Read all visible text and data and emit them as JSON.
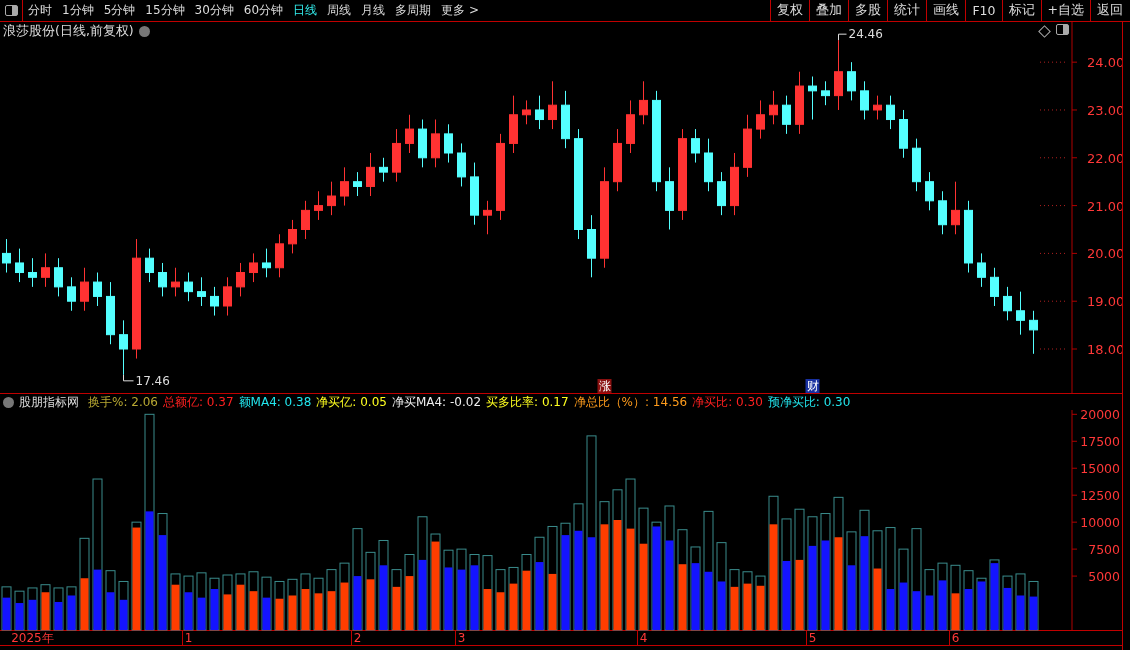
{
  "toolbar": {
    "periods": [
      {
        "label": "分时",
        "selected": false
      },
      {
        "label": "1分钟",
        "selected": false
      },
      {
        "label": "5分钟",
        "selected": false
      },
      {
        "label": "15分钟",
        "selected": false
      },
      {
        "label": "30分钟",
        "selected": false
      },
      {
        "label": "60分钟",
        "selected": false
      },
      {
        "label": "日线",
        "selected": true
      },
      {
        "label": "周线",
        "selected": false
      },
      {
        "label": "月线",
        "selected": false
      },
      {
        "label": "多周期",
        "selected": false
      },
      {
        "label": "更多 >",
        "selected": false
      }
    ],
    "actions": [
      "复权",
      "叠加",
      "多股",
      "统计",
      "画线",
      "F10",
      "标记",
      "+自选",
      "返回"
    ]
  },
  "price_panel": {
    "title": "浪莎股份(日线,前复权)",
    "chart_data": {
      "type": "candlestick",
      "ylim": [
        17.08,
        24.84
      ],
      "yticks": [
        {
          "value": 18,
          "label": "18.00"
        },
        {
          "value": 19,
          "label": "19.00"
        },
        {
          "value": 20,
          "label": "20.00"
        },
        {
          "value": 21,
          "label": "21.00"
        },
        {
          "value": 22,
          "label": "22.00"
        },
        {
          "value": 23,
          "label": "23.00"
        },
        {
          "value": 24,
          "label": "24.00"
        }
      ],
      "categories": [
        null,
        null,
        null,
        null,
        null,
        null,
        null,
        null,
        null,
        null,
        null,
        null,
        null,
        null,
        null,
        null,
        null,
        null,
        null,
        null,
        null,
        null,
        null,
        null,
        null,
        null,
        null,
        null,
        null,
        null,
        null,
        null,
        null,
        null,
        null,
        null,
        null,
        null,
        null,
        null,
        null,
        null,
        null,
        null,
        null,
        null,
        "涨",
        null,
        null,
        null,
        null,
        null,
        null,
        null,
        null,
        null,
        null,
        null,
        null,
        null,
        null,
        null,
        "财",
        null,
        null,
        null,
        null,
        null,
        null,
        null,
        null,
        null,
        null,
        null,
        null,
        null,
        null,
        null,
        null,
        null
      ],
      "ohlc": [
        [
          20.0,
          20.3,
          19.6,
          19.8
        ],
        [
          19.8,
          20.1,
          19.4,
          19.6
        ],
        [
          19.6,
          19.9,
          19.3,
          19.5
        ],
        [
          19.5,
          20.0,
          19.3,
          19.7
        ],
        [
          19.7,
          19.9,
          19.1,
          19.3
        ],
        [
          19.3,
          19.5,
          18.8,
          19.0
        ],
        [
          19.0,
          19.7,
          18.8,
          19.4
        ],
        [
          19.4,
          19.6,
          18.9,
          19.1
        ],
        [
          19.1,
          19.4,
          18.1,
          18.3
        ],
        [
          18.3,
          18.6,
          17.46,
          18.0
        ],
        [
          18.0,
          20.3,
          17.8,
          19.9
        ],
        [
          19.9,
          20.1,
          19.4,
          19.6
        ],
        [
          19.6,
          19.8,
          19.1,
          19.3
        ],
        [
          19.3,
          19.7,
          19.1,
          19.4
        ],
        [
          19.4,
          19.6,
          19.0,
          19.2
        ],
        [
          19.2,
          19.5,
          18.9,
          19.1
        ],
        [
          19.1,
          19.3,
          18.7,
          18.9
        ],
        [
          18.9,
          19.5,
          18.7,
          19.3
        ],
        [
          19.3,
          19.8,
          19.1,
          19.6
        ],
        [
          19.6,
          20.0,
          19.4,
          19.8
        ],
        [
          19.8,
          20.1,
          19.5,
          19.7
        ],
        [
          19.7,
          20.4,
          19.5,
          20.2
        ],
        [
          20.2,
          20.7,
          20.0,
          20.5
        ],
        [
          20.5,
          21.1,
          20.3,
          20.9
        ],
        [
          20.9,
          21.3,
          20.7,
          21.0
        ],
        [
          21.0,
          21.5,
          20.8,
          21.2
        ],
        [
          21.2,
          21.8,
          21.0,
          21.5
        ],
        [
          21.5,
          21.7,
          21.2,
          21.4
        ],
        [
          21.4,
          22.1,
          21.2,
          21.8
        ],
        [
          21.8,
          22.0,
          21.5,
          21.7
        ],
        [
          21.7,
          22.6,
          21.5,
          22.3
        ],
        [
          22.3,
          22.9,
          22.1,
          22.6
        ],
        [
          22.6,
          22.8,
          21.8,
          22.0
        ],
        [
          22.0,
          22.8,
          21.8,
          22.5
        ],
        [
          22.5,
          22.7,
          21.9,
          22.1
        ],
        [
          22.1,
          22.3,
          21.4,
          21.6
        ],
        [
          21.6,
          21.9,
          20.6,
          20.8
        ],
        [
          20.8,
          21.1,
          20.4,
          20.9
        ],
        [
          20.9,
          22.5,
          20.7,
          22.3
        ],
        [
          22.3,
          23.3,
          22.1,
          22.9
        ],
        [
          22.9,
          23.2,
          22.7,
          23.0
        ],
        [
          23.0,
          23.3,
          22.6,
          22.8
        ],
        [
          22.8,
          23.6,
          22.6,
          23.1
        ],
        [
          23.1,
          23.4,
          22.2,
          22.4
        ],
        [
          22.4,
          22.6,
          20.3,
          20.5
        ],
        [
          20.5,
          20.8,
          19.5,
          19.9
        ],
        [
          19.9,
          21.8,
          19.7,
          21.5
        ],
        [
          21.5,
          22.6,
          21.3,
          22.3
        ],
        [
          22.3,
          23.2,
          22.1,
          22.9
        ],
        [
          22.9,
          23.6,
          22.7,
          23.2
        ],
        [
          23.2,
          23.4,
          21.3,
          21.5
        ],
        [
          21.5,
          21.8,
          20.5,
          20.9
        ],
        [
          20.9,
          22.6,
          20.7,
          22.4
        ],
        [
          22.4,
          22.6,
          21.9,
          22.1
        ],
        [
          22.1,
          22.4,
          21.3,
          21.5
        ],
        [
          21.5,
          21.7,
          20.8,
          21.0
        ],
        [
          21.0,
          22.1,
          20.8,
          21.8
        ],
        [
          21.8,
          22.9,
          21.6,
          22.6
        ],
        [
          22.6,
          23.2,
          22.4,
          22.9
        ],
        [
          22.9,
          23.4,
          22.7,
          23.1
        ],
        [
          23.1,
          23.3,
          22.5,
          22.7
        ],
        [
          22.7,
          23.8,
          22.5,
          23.5
        ],
        [
          23.5,
          23.7,
          22.8,
          23.4
        ],
        [
          23.4,
          23.6,
          23.1,
          23.3
        ],
        [
          23.3,
          24.46,
          23.0,
          23.8
        ],
        [
          23.8,
          24.0,
          23.2,
          23.4
        ],
        [
          23.4,
          23.6,
          22.8,
          23.0
        ],
        [
          23.0,
          23.3,
          22.8,
          23.1
        ],
        [
          23.1,
          23.3,
          22.6,
          22.8
        ],
        [
          22.8,
          23.0,
          22.0,
          22.2
        ],
        [
          22.2,
          22.4,
          21.3,
          21.5
        ],
        [
          21.5,
          21.7,
          20.9,
          21.1
        ],
        [
          21.1,
          21.3,
          20.4,
          20.6
        ],
        [
          20.6,
          21.5,
          20.4,
          20.9
        ],
        [
          20.9,
          21.1,
          19.6,
          19.8
        ],
        [
          19.8,
          20.0,
          19.3,
          19.5
        ],
        [
          19.5,
          19.7,
          18.9,
          19.1
        ],
        [
          19.1,
          19.3,
          18.6,
          18.8
        ],
        [
          18.8,
          19.2,
          18.3,
          18.6
        ],
        [
          18.6,
          18.8,
          17.9,
          18.4
        ]
      ],
      "annotations": [
        "17.46",
        "24.46"
      ]
    }
  },
  "indicator_panel": {
    "title": "股朋指标网",
    "readouts": [
      {
        "label": "换手%:",
        "value": "2.06",
        "color": "#b8a832"
      },
      {
        "label": "总额亿:",
        "value": "0.37",
        "color": "#ff2020"
      },
      {
        "label": "额MA4:",
        "value": "0.38",
        "color": "#22e6ee"
      },
      {
        "label": "净买亿:",
        "value": "0.05",
        "color": "#ffff20"
      },
      {
        "label": "净买MA4:",
        "value": "-0.02",
        "color": "#eeeeee"
      },
      {
        "label": "买多比率:",
        "value": "0.17",
        "color": "#ffff20"
      },
      {
        "label": "净总比（%）:",
        "value": "14.56",
        "color": "#ff9c1c"
      },
      {
        "label": "净买比:",
        "value": "0.30",
        "color": "#ff2020"
      },
      {
        "label": "预净买比:",
        "value": "0.30",
        "color": "#22e6ee"
      }
    ],
    "chart_data": {
      "type": "bar",
      "ylim": [
        0,
        20400
      ],
      "yticks": [
        {
          "value": 5000,
          "label": "5000"
        },
        {
          "value": 7500,
          "label": "7500"
        },
        {
          "value": 10000,
          "label": "10000"
        },
        {
          "value": 12500,
          "label": "12500"
        },
        {
          "value": 15000,
          "label": "15000"
        },
        {
          "value": 17500,
          "label": "17500"
        },
        {
          "value": 20000,
          "label": "20000"
        }
      ],
      "categories": [
        null,
        null,
        "2025年",
        null,
        null,
        null,
        null,
        null,
        null,
        null,
        null,
        null,
        null,
        null,
        "1",
        null,
        null,
        null,
        null,
        null,
        null,
        null,
        null,
        null,
        null,
        null,
        null,
        "2",
        null,
        null,
        null,
        null,
        null,
        null,
        null,
        "3",
        null,
        null,
        null,
        null,
        null,
        null,
        null,
        null,
        null,
        null,
        null,
        null,
        null,
        "4",
        null,
        null,
        null,
        null,
        null,
        null,
        null,
        null,
        null,
        null,
        null,
        null,
        "5",
        null,
        null,
        null,
        null,
        null,
        null,
        null,
        null,
        null,
        null,
        "6",
        null,
        null,
        null,
        null,
        null,
        null
      ],
      "series": [
        {
          "color": "#3a8c8c",
          "values": [
            4000,
            3600,
            3900,
            4200,
            3900,
            4000,
            8500,
            14000,
            5500,
            4500,
            10000,
            20000,
            10800,
            5200,
            5000,
            5300,
            4800,
            5100,
            5200,
            5400,
            4900,
            4500,
            4700,
            5200,
            4800,
            5600,
            6200,
            9400,
            7200,
            8300,
            5600,
            7000,
            10500,
            8900,
            7400,
            7500,
            7000,
            6900,
            5600,
            5800,
            7000,
            8600,
            9600,
            9900,
            11700,
            18000,
            11900,
            13000,
            14000,
            11300,
            10000,
            11500,
            9300,
            7700,
            11000,
            8100,
            5600,
            5400,
            5000,
            12400,
            10300,
            11200,
            10500,
            10800,
            12300,
            9100,
            11100,
            9200,
            9500,
            7500,
            9400,
            5600,
            6200,
            6000,
            5500,
            4800,
            6500,
            5000,
            5200,
            4500
          ]
        },
        {
          "color": "#ff3d00",
          "values": [
            null,
            null,
            null,
            3500,
            null,
            null,
            4800,
            null,
            null,
            null,
            9500,
            null,
            null,
            4200,
            null,
            null,
            null,
            3300,
            4200,
            3600,
            null,
            2900,
            3200,
            3800,
            3400,
            3600,
            4400,
            null,
            4700,
            null,
            4000,
            5000,
            null,
            8200,
            null,
            null,
            null,
            3800,
            3500,
            4300,
            5500,
            null,
            5200,
            null,
            null,
            null,
            9800,
            10200,
            9400,
            8000,
            null,
            null,
            6100,
            null,
            null,
            null,
            4000,
            4300,
            4100,
            9800,
            null,
            6500,
            null,
            null,
            8600,
            null,
            null,
            5700,
            null,
            null,
            null,
            null,
            null,
            3400,
            null,
            null,
            null,
            null,
            null,
            null
          ]
        },
        {
          "color": "#1414ff",
          "values": [
            3000,
            2500,
            2800,
            null,
            2600,
            3200,
            null,
            5600,
            3500,
            2800,
            null,
            11000,
            8800,
            null,
            3500,
            3000,
            3800,
            null,
            null,
            null,
            3000,
            null,
            null,
            null,
            null,
            null,
            null,
            5000,
            null,
            6000,
            null,
            null,
            6500,
            null,
            5800,
            5600,
            6000,
            null,
            null,
            null,
            null,
            6300,
            null,
            8800,
            9200,
            8600,
            null,
            null,
            null,
            null,
            9600,
            8300,
            null,
            6200,
            5400,
            4500,
            null,
            null,
            null,
            null,
            6400,
            null,
            7800,
            8300,
            null,
            6000,
            8700,
            null,
            3800,
            4400,
            3600,
            3200,
            4600,
            null,
            3800,
            4500,
            6200,
            3900,
            3200,
            3100
          ]
        }
      ]
    }
  }
}
